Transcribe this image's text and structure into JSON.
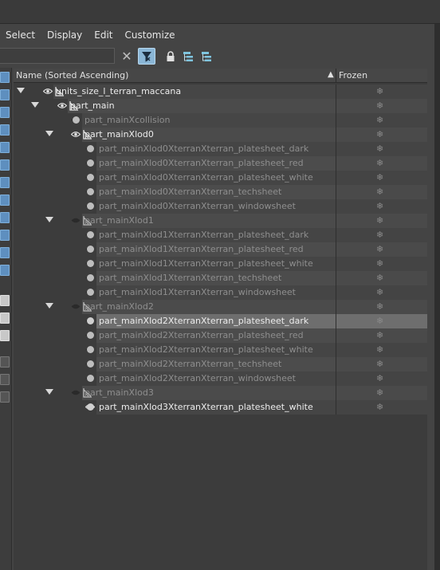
{
  "menu": {
    "items": [
      "Select",
      "Display",
      "Edit",
      "Customize"
    ]
  },
  "toolbar": {
    "search_value": "",
    "clear_icon": "close-icon",
    "filter_icon": "filter-icon",
    "lock_icon": "lock-icon",
    "hierarchy_icon_1": "hierarchy-icon",
    "hierarchy_icon_2": "hierarchy-icon"
  },
  "columns": {
    "name": "Name (Sorted Ascending)",
    "frozen": "Frozen",
    "sort_arrow": "▲"
  },
  "rows": [
    {
      "label": "units_size_l_terran_maccana",
      "depth": 0,
      "expander": true,
      "eye": true,
      "icon": "bone",
      "style": "bright"
    },
    {
      "label": "part_main",
      "depth": 1,
      "expander": true,
      "eye": true,
      "icon": "bone",
      "style": "bright"
    },
    {
      "label": "part_mainXcollision",
      "depth": 2,
      "expander": false,
      "eye": false,
      "icon": "dot",
      "style": "dim"
    },
    {
      "label": "part_mainXlod0",
      "depth": 2,
      "expander": true,
      "eye": true,
      "icon": "bone",
      "style": "bright"
    },
    {
      "label": "part_mainXlod0XterranXterran_platesheet_dark",
      "depth": 3,
      "expander": false,
      "eye": false,
      "icon": "dot",
      "style": "dim"
    },
    {
      "label": "part_mainXlod0XterranXterran_platesheet_red",
      "depth": 3,
      "expander": false,
      "eye": false,
      "icon": "dot",
      "style": "dim"
    },
    {
      "label": "part_mainXlod0XterranXterran_platesheet_white",
      "depth": 3,
      "expander": false,
      "eye": false,
      "icon": "dot",
      "style": "dim"
    },
    {
      "label": "part_mainXlod0XterranXterran_techsheet",
      "depth": 3,
      "expander": false,
      "eye": false,
      "icon": "dot",
      "style": "dim"
    },
    {
      "label": "part_mainXlod0XterranXterran_windowsheet",
      "depth": 3,
      "expander": false,
      "eye": false,
      "icon": "dot",
      "style": "dim"
    },
    {
      "label": "part_mainXlod1",
      "depth": 2,
      "expander": true,
      "eye": false,
      "icon": "bone",
      "style": "dim"
    },
    {
      "label": "part_mainXlod1XterranXterran_platesheet_dark",
      "depth": 3,
      "expander": false,
      "eye": false,
      "icon": "dot",
      "style": "dim"
    },
    {
      "label": "part_mainXlod1XterranXterran_platesheet_red",
      "depth": 3,
      "expander": false,
      "eye": false,
      "icon": "dot",
      "style": "dim"
    },
    {
      "label": "part_mainXlod1XterranXterran_platesheet_white",
      "depth": 3,
      "expander": false,
      "eye": false,
      "icon": "dot",
      "style": "dim"
    },
    {
      "label": "part_mainXlod1XterranXterran_techsheet",
      "depth": 3,
      "expander": false,
      "eye": false,
      "icon": "dot",
      "style": "dim"
    },
    {
      "label": "part_mainXlod1XterranXterran_windowsheet",
      "depth": 3,
      "expander": false,
      "eye": false,
      "icon": "dot",
      "style": "dim"
    },
    {
      "label": "part_mainXlod2",
      "depth": 2,
      "expander": true,
      "eye": false,
      "icon": "bone",
      "style": "dim"
    },
    {
      "label": "part_mainXlod2XterranXterran_platesheet_dark",
      "depth": 3,
      "expander": false,
      "eye": false,
      "icon": "dot",
      "style": "selected"
    },
    {
      "label": "part_mainXlod2XterranXterran_platesheet_red",
      "depth": 3,
      "expander": false,
      "eye": false,
      "icon": "dot",
      "style": "dim"
    },
    {
      "label": "part_mainXlod2XterranXterran_platesheet_white",
      "depth": 3,
      "expander": false,
      "eye": false,
      "icon": "dot",
      "style": "dim"
    },
    {
      "label": "part_mainXlod2XterranXterran_techsheet",
      "depth": 3,
      "expander": false,
      "eye": false,
      "icon": "dot",
      "style": "dim"
    },
    {
      "label": "part_mainXlod2XterranXterran_windowsheet",
      "depth": 3,
      "expander": false,
      "eye": false,
      "icon": "dot",
      "style": "dim"
    },
    {
      "label": "part_mainXlod3",
      "depth": 2,
      "expander": true,
      "eye": false,
      "icon": "bone",
      "style": "dim"
    },
    {
      "label": "part_mainXlod3XterranXterran_platesheet_white",
      "depth": 3,
      "expander": false,
      "eye": true,
      "icon": "dot",
      "style": "bright"
    }
  ],
  "frozen_icon": "❄",
  "colors": {
    "panel": "#3c3c3c",
    "row_band": "#4a4a4a",
    "selected": "#6e6e6e",
    "accent": "#8ab6d6"
  }
}
